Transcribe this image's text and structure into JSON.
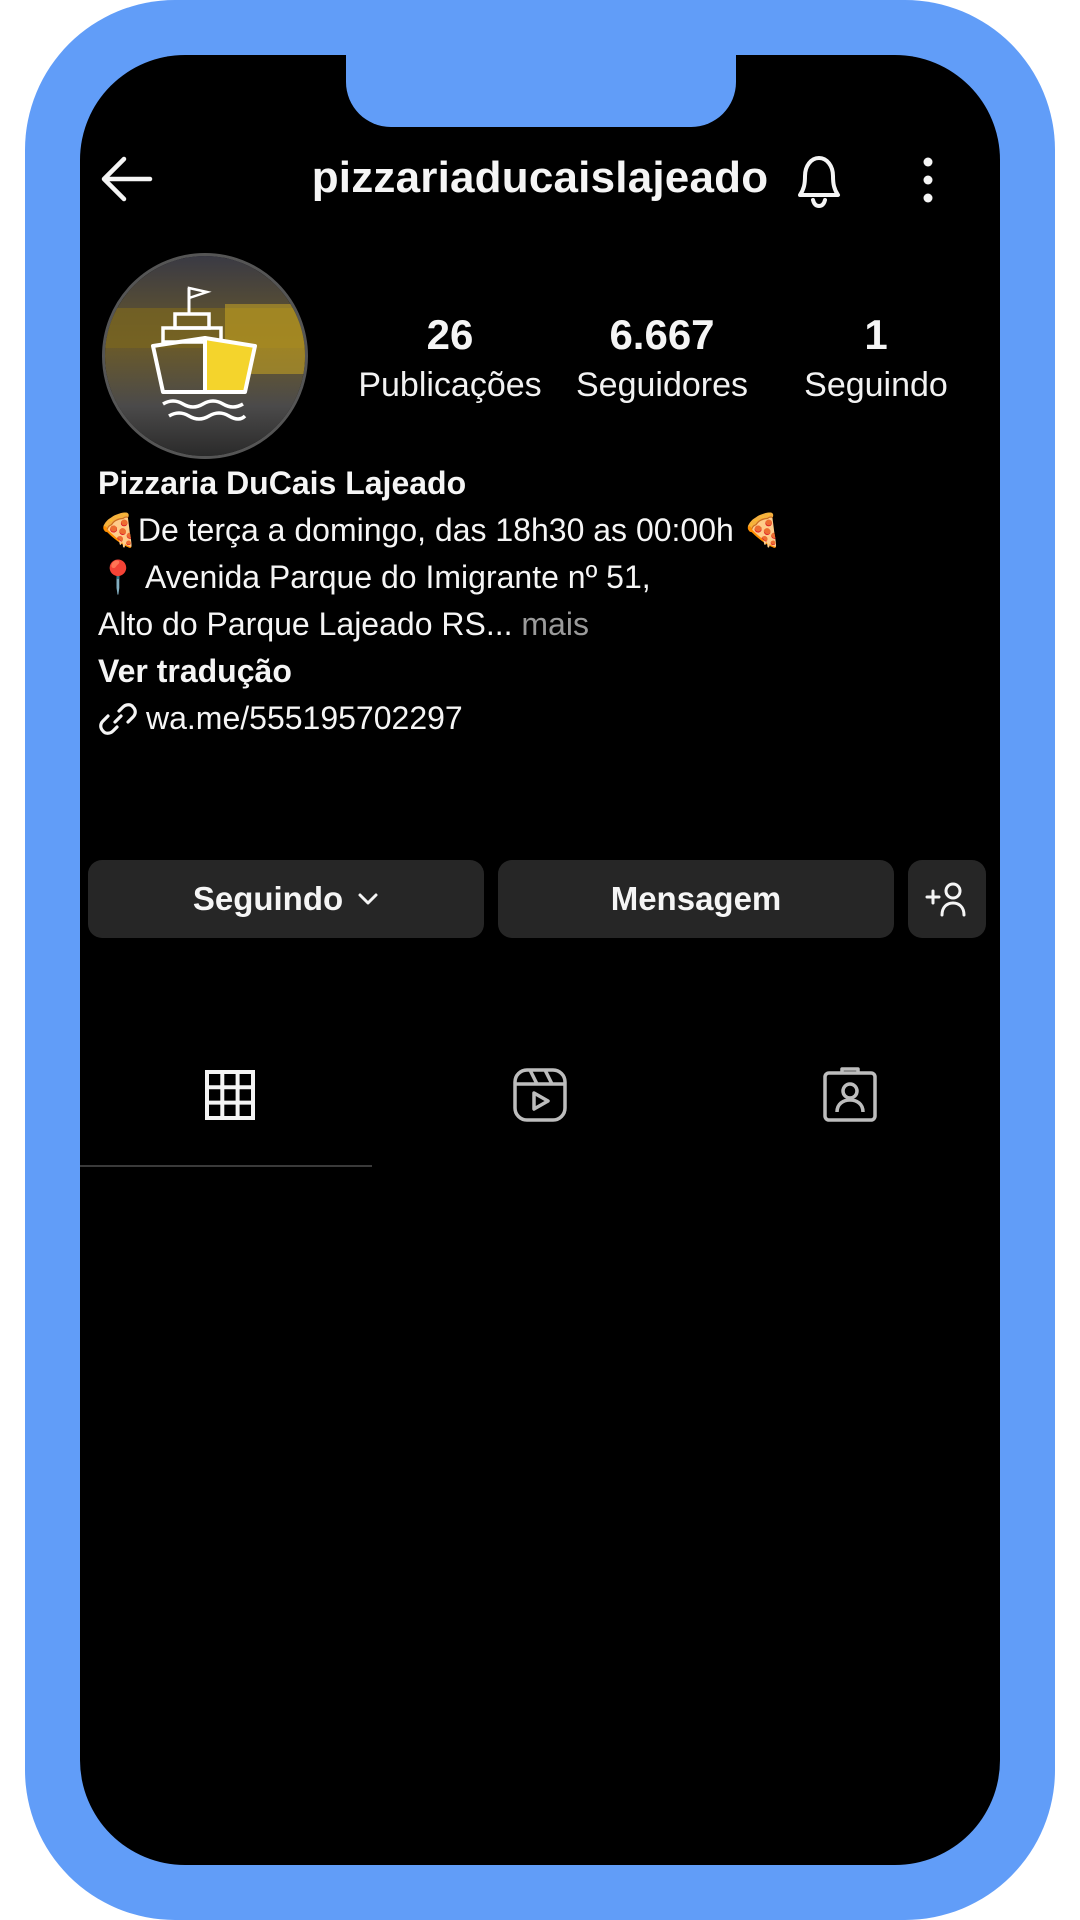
{
  "header": {
    "username": "pizzariaducaislajeado"
  },
  "stats": [
    {
      "value": "26",
      "label": "Publicações"
    },
    {
      "value": "6.667",
      "label": "Seguidores"
    },
    {
      "value": "1",
      "label": "Seguindo"
    }
  ],
  "bio": {
    "name": "Pizzaria DuCais Lajeado",
    "line1": "🍕De terça a domingo, das 18h30 as 00:00h 🍕",
    "line2": "📍 Avenida Parque do Imigrante nº 51,",
    "line3": "Alto do Parque Lajeado RS...",
    "more": " mais",
    "translate": "Ver tradução",
    "link": "wa.me/555195702297"
  },
  "actions": {
    "following_label": "Seguindo",
    "message_label": "Mensagem"
  },
  "icons": {
    "back": "arrow-left-icon",
    "bell": "bell-icon",
    "more": "more-vertical-icon",
    "link": "link-icon",
    "chevron": "chevron-down-icon",
    "add_user": "add-user-icon",
    "grid": "grid-icon",
    "reels": "reels-icon",
    "tagged": "tagged-icon"
  },
  "colors": {
    "frame": "#619df8",
    "background": "#000000",
    "button": "#262626",
    "muted": "#9b9b9b",
    "pizza_yellow": "#f4d42c"
  }
}
